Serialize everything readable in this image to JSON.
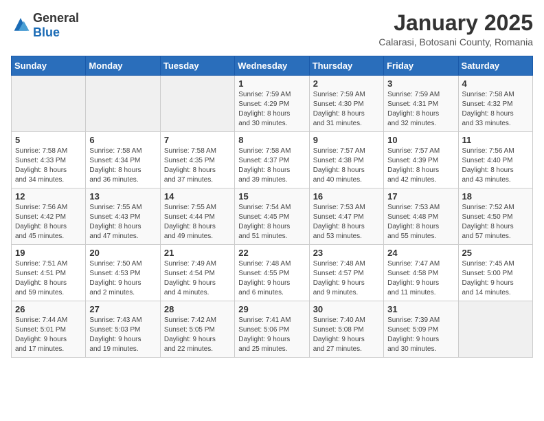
{
  "logo": {
    "general": "General",
    "blue": "Blue"
  },
  "title": "January 2025",
  "subtitle": "Calarasi, Botosani County, Romania",
  "headers": [
    "Sunday",
    "Monday",
    "Tuesday",
    "Wednesday",
    "Thursday",
    "Friday",
    "Saturday"
  ],
  "weeks": [
    [
      {
        "day": "",
        "info": ""
      },
      {
        "day": "",
        "info": ""
      },
      {
        "day": "",
        "info": ""
      },
      {
        "day": "1",
        "info": "Sunrise: 7:59 AM\nSunset: 4:29 PM\nDaylight: 8 hours\nand 30 minutes."
      },
      {
        "day": "2",
        "info": "Sunrise: 7:59 AM\nSunset: 4:30 PM\nDaylight: 8 hours\nand 31 minutes."
      },
      {
        "day": "3",
        "info": "Sunrise: 7:59 AM\nSunset: 4:31 PM\nDaylight: 8 hours\nand 32 minutes."
      },
      {
        "day": "4",
        "info": "Sunrise: 7:58 AM\nSunset: 4:32 PM\nDaylight: 8 hours\nand 33 minutes."
      }
    ],
    [
      {
        "day": "5",
        "info": "Sunrise: 7:58 AM\nSunset: 4:33 PM\nDaylight: 8 hours\nand 34 minutes."
      },
      {
        "day": "6",
        "info": "Sunrise: 7:58 AM\nSunset: 4:34 PM\nDaylight: 8 hours\nand 36 minutes."
      },
      {
        "day": "7",
        "info": "Sunrise: 7:58 AM\nSunset: 4:35 PM\nDaylight: 8 hours\nand 37 minutes."
      },
      {
        "day": "8",
        "info": "Sunrise: 7:58 AM\nSunset: 4:37 PM\nDaylight: 8 hours\nand 39 minutes."
      },
      {
        "day": "9",
        "info": "Sunrise: 7:57 AM\nSunset: 4:38 PM\nDaylight: 8 hours\nand 40 minutes."
      },
      {
        "day": "10",
        "info": "Sunrise: 7:57 AM\nSunset: 4:39 PM\nDaylight: 8 hours\nand 42 minutes."
      },
      {
        "day": "11",
        "info": "Sunrise: 7:56 AM\nSunset: 4:40 PM\nDaylight: 8 hours\nand 43 minutes."
      }
    ],
    [
      {
        "day": "12",
        "info": "Sunrise: 7:56 AM\nSunset: 4:42 PM\nDaylight: 8 hours\nand 45 minutes."
      },
      {
        "day": "13",
        "info": "Sunrise: 7:55 AM\nSunset: 4:43 PM\nDaylight: 8 hours\nand 47 minutes."
      },
      {
        "day": "14",
        "info": "Sunrise: 7:55 AM\nSunset: 4:44 PM\nDaylight: 8 hours\nand 49 minutes."
      },
      {
        "day": "15",
        "info": "Sunrise: 7:54 AM\nSunset: 4:45 PM\nDaylight: 8 hours\nand 51 minutes."
      },
      {
        "day": "16",
        "info": "Sunrise: 7:53 AM\nSunset: 4:47 PM\nDaylight: 8 hours\nand 53 minutes."
      },
      {
        "day": "17",
        "info": "Sunrise: 7:53 AM\nSunset: 4:48 PM\nDaylight: 8 hours\nand 55 minutes."
      },
      {
        "day": "18",
        "info": "Sunrise: 7:52 AM\nSunset: 4:50 PM\nDaylight: 8 hours\nand 57 minutes."
      }
    ],
    [
      {
        "day": "19",
        "info": "Sunrise: 7:51 AM\nSunset: 4:51 PM\nDaylight: 8 hours\nand 59 minutes."
      },
      {
        "day": "20",
        "info": "Sunrise: 7:50 AM\nSunset: 4:53 PM\nDaylight: 9 hours\nand 2 minutes."
      },
      {
        "day": "21",
        "info": "Sunrise: 7:49 AM\nSunset: 4:54 PM\nDaylight: 9 hours\nand 4 minutes."
      },
      {
        "day": "22",
        "info": "Sunrise: 7:48 AM\nSunset: 4:55 PM\nDaylight: 9 hours\nand 6 minutes."
      },
      {
        "day": "23",
        "info": "Sunrise: 7:48 AM\nSunset: 4:57 PM\nDaylight: 9 hours\nand 9 minutes."
      },
      {
        "day": "24",
        "info": "Sunrise: 7:47 AM\nSunset: 4:58 PM\nDaylight: 9 hours\nand 11 minutes."
      },
      {
        "day": "25",
        "info": "Sunrise: 7:45 AM\nSunset: 5:00 PM\nDaylight: 9 hours\nand 14 minutes."
      }
    ],
    [
      {
        "day": "26",
        "info": "Sunrise: 7:44 AM\nSunset: 5:01 PM\nDaylight: 9 hours\nand 17 minutes."
      },
      {
        "day": "27",
        "info": "Sunrise: 7:43 AM\nSunset: 5:03 PM\nDaylight: 9 hours\nand 19 minutes."
      },
      {
        "day": "28",
        "info": "Sunrise: 7:42 AM\nSunset: 5:05 PM\nDaylight: 9 hours\nand 22 minutes."
      },
      {
        "day": "29",
        "info": "Sunrise: 7:41 AM\nSunset: 5:06 PM\nDaylight: 9 hours\nand 25 minutes."
      },
      {
        "day": "30",
        "info": "Sunrise: 7:40 AM\nSunset: 5:08 PM\nDaylight: 9 hours\nand 27 minutes."
      },
      {
        "day": "31",
        "info": "Sunrise: 7:39 AM\nSunset: 5:09 PM\nDaylight: 9 hours\nand 30 minutes."
      },
      {
        "day": "",
        "info": ""
      }
    ]
  ]
}
